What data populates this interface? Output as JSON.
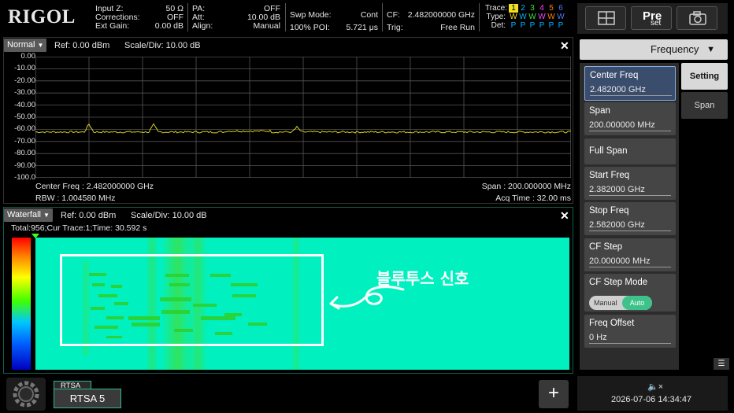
{
  "logo": "RIGOL",
  "status": {
    "col1": [
      {
        "label": "Input Z:",
        "value": "50 Ω"
      },
      {
        "label": "Corrections:",
        "value": "OFF"
      },
      {
        "label": "Ext Gain:",
        "value": "0.00 dB"
      }
    ],
    "col2": [
      {
        "label": "PA:",
        "value": "OFF"
      },
      {
        "label": "Att:",
        "value": "10.00 dB"
      },
      {
        "label": "Align:",
        "value": "Manual"
      }
    ],
    "col3": [
      {
        "label": "Swp Mode:",
        "value": "Cont"
      },
      {
        "label": "100% POI:",
        "value": "5.721 μs"
      }
    ],
    "col4": [
      {
        "label": "CF:",
        "value": "2.482000000 GHz"
      },
      {
        "label": "Trig:",
        "value": "Free Run"
      }
    ],
    "trace": {
      "labels": [
        "Trace:",
        "Type:",
        "Det:"
      ],
      "numbers": [
        "1",
        "2",
        "3",
        "4",
        "5",
        "6"
      ],
      "types": [
        "W",
        "W",
        "W",
        "W",
        "W",
        "W"
      ],
      "dets": [
        "P",
        "P",
        "P",
        "P",
        "P",
        "P"
      ]
    }
  },
  "spectrum": {
    "mode": "Normal",
    "ref": "Ref: 0.00 dBm",
    "scale": "Scale/Div: 10.00 dB",
    "y_ticks": [
      "0.00",
      "-10.00",
      "-20.00",
      "-30.00",
      "-40.00",
      "-50.00",
      "-60.00",
      "-70.00",
      "-80.00",
      "-90.00",
      "-100.0"
    ],
    "center_freq": "Center Freq : 2.482000000 GHz",
    "rbw": "RBW : 1.004580 MHz",
    "span": "Span : 200.000000 MHz",
    "acq_time": "Acq Time : 32.00 ms",
    "trace_color": "#d8d020"
  },
  "waterfall": {
    "mode": "Waterfall",
    "ref": "Ref: 0.00 dBm",
    "scale": "Scale/Div: 10.00 dB",
    "info": "Total:956;Cur Trace:1;Time: 30.592  s",
    "bg_color": "#00f0c0"
  },
  "annotation": {
    "text": "블루투스 신호"
  },
  "bottom": {
    "tab_small": "RTSA",
    "tab_main": "RTSA 5",
    "add": "+"
  },
  "right": {
    "menu_title": "Frequency",
    "side_tabs": [
      "Setting",
      "Span"
    ],
    "params": [
      {
        "label": "Center Freq",
        "value": "2.482000 GHz"
      },
      {
        "label": "Span",
        "value": "200.000000 MHz"
      },
      {
        "label": "Full Span",
        "value": ""
      },
      {
        "label": "Start Freq",
        "value": "2.382000 GHz"
      },
      {
        "label": "Stop Freq",
        "value": "2.582000 GHz"
      },
      {
        "label": "CF Step",
        "value": "20.000000 MHz"
      },
      {
        "label": "CF Step Mode",
        "value": ""
      },
      {
        "label": "Freq Offset",
        "value": "0 Hz"
      }
    ],
    "cf_step_mode": {
      "off": "Manual",
      "on": "Auto"
    },
    "datetime": "2026-07-06 14:34:47",
    "preset_top": "Pre",
    "preset_bottom": "set"
  }
}
